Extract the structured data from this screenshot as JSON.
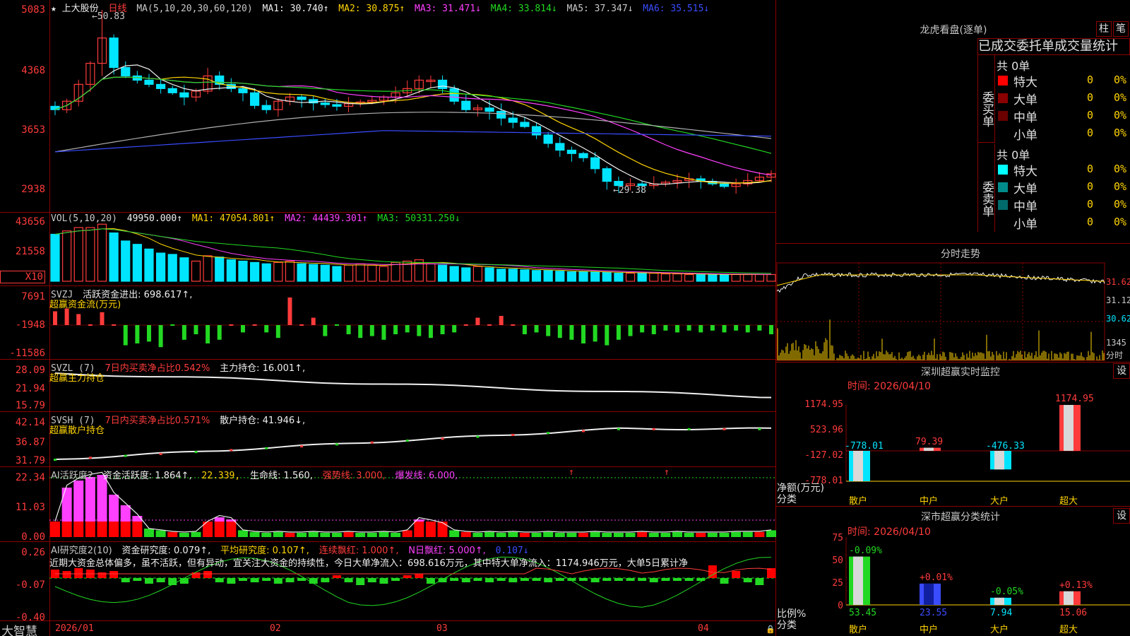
{
  "axes": {
    "main": [
      "5083",
      "4368",
      "3653",
      "2938"
    ],
    "vol": [
      "43656",
      "21558",
      "X10"
    ],
    "svzj": [
      "7691",
      "-1948",
      "-11586"
    ],
    "svzl": [
      "28.09",
      "21.94",
      "15.79"
    ],
    "svsh": [
      "42.14",
      "36.87",
      "31.79"
    ],
    "ai": [
      "22.34",
      "11.03",
      "0.00"
    ],
    "air": [
      "0.26",
      "-0.07",
      "-0.40"
    ]
  },
  "main_header": {
    "star": "★",
    "stock": "上大股份",
    "period": "日线",
    "ma_def": "MA(5,10,20,30,60,120)",
    "ma1": "MA1: 30.740↑",
    "ma2": "MA2: 30.875↑",
    "ma3": "MA3: 31.471↓",
    "ma4": "MA4: 33.814↓",
    "ma5": "MA5: 37.347↓",
    "ma6": "MA6: 35.515↓",
    "high_mark": "←50.83",
    "low_mark": "←29.38"
  },
  "vol_header": {
    "def": "VOL(5,10,20)",
    "value": "49950.000↑",
    "ma1": "MA1: 47054.801↑",
    "ma2": "MA2: 44439.301↑",
    "ma3": "MA3: 50331.250↓"
  },
  "svzj_header": {
    "def": "SVZJ",
    "text": "活跃资金进出: 698.617↑,",
    "sub": "超赢资金流(万元)"
  },
  "svzl_header": {
    "def": "SVZL (7)",
    "text1": "7日内买卖净占比0.542%",
    "text2": "主力持仓: 16.001↑,",
    "sub": "超赢主力持仓"
  },
  "svsh_header": {
    "def": "SVSH (7)",
    "text1": "7日内买卖净占比0.571%",
    "text2": "散户持仓: 41.946↓,",
    "sub": "超赢散户持仓"
  },
  "ai_header": {
    "def": "AI活跃度2",
    "t1": "资金活跃度: 1.864↑,",
    "t2": "22.339,",
    "t3": "生命线: 1.560,",
    "t4": "强势线: 3.000,",
    "t5": "爆发线: 6.000,"
  },
  "air_header": {
    "def": "AI研究度2(10)",
    "t1": "资金研究度: 0.079↑,",
    "t2": "平均研究度: 0.107↑,",
    "t3": "连续飘红: 1.000↑,",
    "t4": "N日飘红: 5.000↑,",
    "t5": "0.107↓",
    "comment": "近期大资金总体偏多，虽不活跃，但有异动，宜关注大资金的持续性，今日大单净流入：698.616万元，其中特大单净流入：1174.946万元，大单5日累计净"
  },
  "date_axis": {
    "brand": "大智慧",
    "d1": "2026/01",
    "d2": "02",
    "d3": "03",
    "d4": "04"
  },
  "longhu": {
    "title": "龙虎看盘(逐单)",
    "btn1": "柱",
    "btn2": "笔",
    "subtitle": "已成交委托单成交量统计",
    "buy_label": "委买单",
    "sell_label": "委卖单",
    "buy_total": "共 0单",
    "sell_total": "共 0单",
    "buy_rows": [
      {
        "name": "特大",
        "count": "0",
        "pct": "0%",
        "color": "#ff0000"
      },
      {
        "name": "大单",
        "count": "0",
        "pct": "0%",
        "color": "#8b0000"
      },
      {
        "name": "中单",
        "count": "0",
        "pct": "0%",
        "color": "#6b0000"
      },
      {
        "name": "小单",
        "count": "0",
        "pct": "0%",
        "color": "#000000"
      }
    ],
    "sell_rows": [
      {
        "name": "特大",
        "count": "0",
        "pct": "0%",
        "color": "#00ffff"
      },
      {
        "name": "大单",
        "count": "0",
        "pct": "0%",
        "color": "#008b8b"
      },
      {
        "name": "中单",
        "count": "0",
        "pct": "0%",
        "color": "#006b6b"
      },
      {
        "name": "小单",
        "count": "0",
        "pct": "0%",
        "color": "#000000"
      }
    ]
  },
  "intraday": {
    "title": "分时走势",
    "y_labels": [
      "31.62",
      "31.12",
      "30.62"
    ],
    "vol_label": "1345",
    "unit": "分时"
  },
  "sz_monitor": {
    "title": "深圳超赢实时监控",
    "btn": "设",
    "time": "时间: 2026/04/10",
    "y_labels": [
      "1174.95",
      "523.96",
      "-127.02",
      "-778.01"
    ],
    "y_title": "净额(万元)",
    "x_title": "分类",
    "categories": [
      "散户",
      "中户",
      "大户",
      "超大"
    ],
    "values": [
      -778.01,
      79.39,
      -476.33,
      1174.95
    ],
    "value_labels": [
      "-778.01",
      "79.39",
      "-476.33",
      "1174.95"
    ]
  },
  "sz_class": {
    "title": "深市超赢分类统计",
    "btn": "设",
    "time": "时间: 2026/04/10",
    "y_labels": [
      "75",
      "50",
      "25",
      "0"
    ],
    "y_title": "比例%",
    "x_title": "分类",
    "categories": [
      "散户",
      "中户",
      "大户",
      "超大"
    ],
    "values": [
      53.45,
      23.55,
      7.94,
      15.06
    ],
    "value_labels": [
      "53.45",
      "23.55",
      "7.94",
      "15.06"
    ],
    "change_labels": [
      "-0.09%",
      "+0.01%",
      "-0.05%",
      "+0.13%"
    ]
  },
  "colors": {
    "up": "#ff3b3b",
    "down": "#00e5ff",
    "grid": "#8a0000"
  }
}
